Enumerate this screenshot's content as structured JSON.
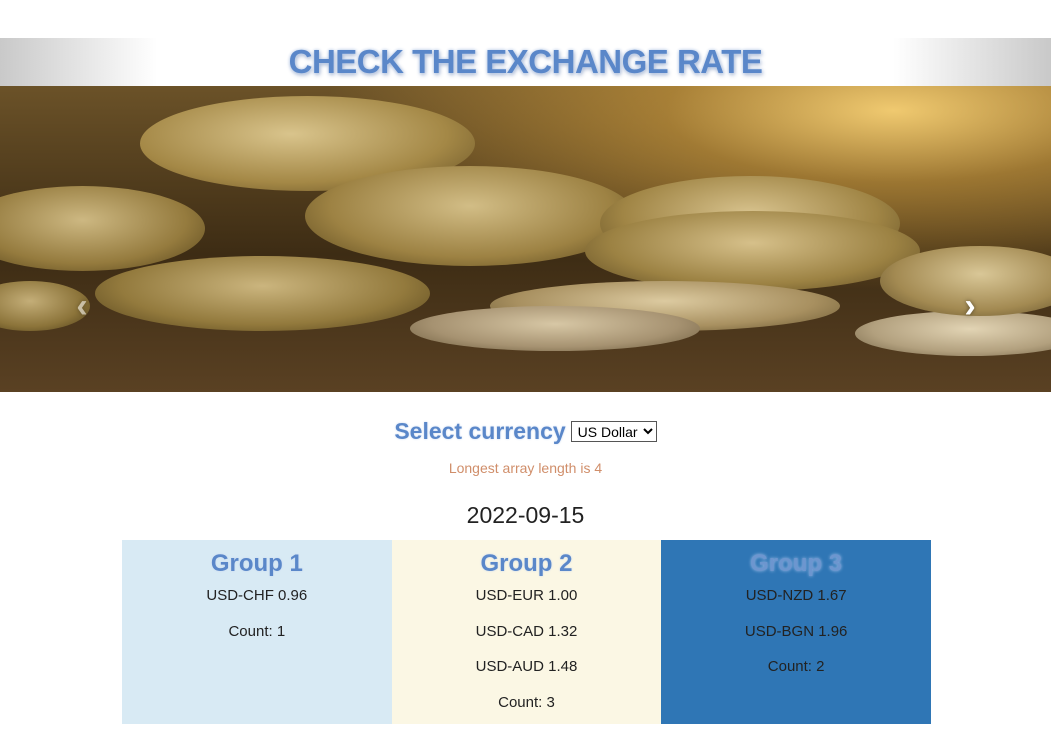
{
  "header": {
    "title": "CHECK THE EXCHANGE RATE"
  },
  "carousel": {
    "prev_icon": "chevron-left-icon",
    "next_icon": "chevron-right-icon",
    "prev_glyph": "‹",
    "next_glyph": "›",
    "slide_count": 3,
    "active_slide": 3
  },
  "currency": {
    "label": "Select currency",
    "selected": "US Dollar"
  },
  "longest_text": "Longest array length is 4",
  "date": "2022-09-15",
  "groups": [
    {
      "title": "Group 1",
      "rates": [
        "USD-CHF 0.96"
      ],
      "count": "Count: 1"
    },
    {
      "title": "Group 2",
      "rates": [
        "USD-EUR 1.00",
        "USD-CAD 1.32",
        "USD-AUD 1.48"
      ],
      "count": "Count: 3"
    },
    {
      "title": "Group 3",
      "rates": [
        "USD-NZD 1.67",
        "USD-BGN 1.96"
      ],
      "count": "Count: 2"
    }
  ],
  "colors": {
    "title_blue": "#5a87c9",
    "group1_bg": "#d8eaf4",
    "group2_bg": "#fbf7e4",
    "group3_bg": "#2f76b5",
    "note_orange": "#d08e6a"
  }
}
